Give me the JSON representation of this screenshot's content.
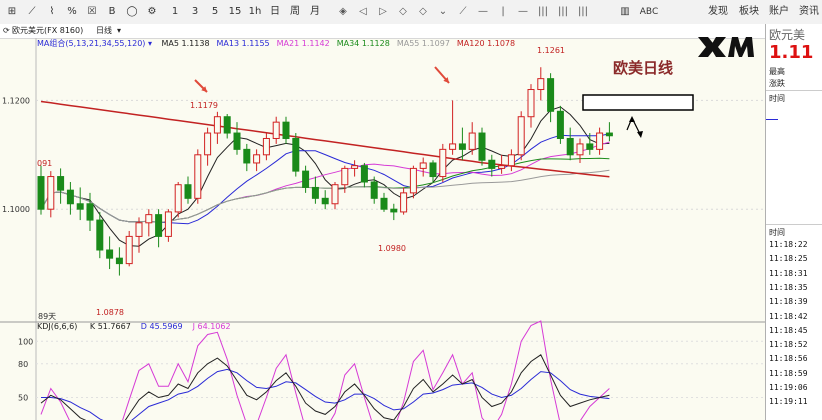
{
  "toolbar": {
    "tools": [
      {
        "name": "cursor",
        "label": "⊞"
      },
      {
        "name": "line-chart",
        "label": "⟋"
      },
      {
        "name": "candle",
        "label": "⌇"
      },
      {
        "name": "percent",
        "label": "%"
      },
      {
        "name": "x-box",
        "label": "☒"
      },
      {
        "name": "b-box",
        "label": "B"
      },
      {
        "name": "circle",
        "label": "◯"
      },
      {
        "name": "gear",
        "label": "⚙"
      }
    ],
    "periods": [
      "1",
      "3",
      "5",
      "15",
      "1h",
      "日",
      "周",
      "月"
    ],
    "nav": [
      "◈",
      "◁",
      "▷",
      "◇",
      "◇",
      "⌄",
      "⟋",
      "—",
      "|",
      "—",
      "|||",
      "|||",
      "|||"
    ],
    "right_items": [
      "ABC",
      "发现",
      "板块",
      "账户",
      "资讯"
    ]
  },
  "tab": {
    "symbol": "欧元美元(FX 8160)",
    "period": "日线"
  },
  "overlay": {
    "ma_title": "MA组合(5,13,21,34,55,120)",
    "ma": [
      {
        "label": "MA5 1.1138",
        "color": "#222222"
      },
      {
        "label": "MA13 1.1155",
        "color": "#2a2ad6"
      },
      {
        "label": "MA21 1.1142",
        "color": "#d63ad6"
      },
      {
        "label": "MA34 1.1128",
        "color": "#1c8c1c"
      },
      {
        "label": "MA55 1.1097",
        "color": "#9a9a9a"
      },
      {
        "label": "MA120 1.1078",
        "color": "#c22222"
      }
    ],
    "kdj_title": "KDJ(6,6,6)",
    "kdj": [
      {
        "label": "K 51.7667",
        "color": "#222222"
      },
      {
        "label": "D 45.5969",
        "color": "#2a2ad6"
      },
      {
        "label": "J 64.1062",
        "color": "#d63ad6"
      }
    ],
    "price_labels": {
      "high_right": "1.1261",
      "high_left": "1.1179",
      "low_mid": "1.0980",
      "low_left": "1.0878",
      "left_edge": "091"
    },
    "axis_ticks": [
      "1.1200",
      "1.1000"
    ],
    "kdj_ticks": [
      "100",
      "80",
      "50"
    ],
    "bottom_label": "89天"
  },
  "brand": {
    "title": "欧美日线",
    "logo": "XM"
  },
  "right_panel": {
    "symbol": "欧元美",
    "price": "1.11",
    "labels": [
      "最高",
      "涨跌"
    ],
    "section1": "时间",
    "section2": "时间",
    "times": [
      "11:18:22",
      "11:18:25",
      "11:18:31",
      "11:18:35",
      "11:18:39",
      "11:18:42",
      "11:18:45",
      "11:18:52",
      "11:18:56",
      "11:18:59",
      "11:19:06",
      "11:19:11"
    ]
  },
  "chart_data": {
    "type": "candlestick",
    "title": "欧美日线",
    "y_range": [
      1.08,
      1.13
    ],
    "candles": [
      {
        "o": 1.106,
        "h": 1.108,
        "l": 1.099,
        "c": 1.1
      },
      {
        "o": 1.1,
        "h": 1.107,
        "l": 1.0985,
        "c": 1.106
      },
      {
        "o": 1.106,
        "h": 1.1075,
        "l": 1.101,
        "c": 1.1035
      },
      {
        "o": 1.1035,
        "h": 1.105,
        "l": 1.099,
        "c": 1.101
      },
      {
        "o": 1.101,
        "h": 1.104,
        "l": 1.098,
        "c": 1.1
      },
      {
        "o": 1.101,
        "h": 1.103,
        "l": 1.096,
        "c": 1.098
      },
      {
        "o": 1.098,
        "h": 1.0995,
        "l": 1.091,
        "c": 1.0925
      },
      {
        "o": 1.0925,
        "h": 1.095,
        "l": 1.089,
        "c": 1.091
      },
      {
        "o": 1.091,
        "h": 1.093,
        "l": 1.0878,
        "c": 1.09
      },
      {
        "o": 1.09,
        "h": 1.096,
        "l": 1.0895,
        "c": 1.095
      },
      {
        "o": 1.095,
        "h": 1.0985,
        "l": 1.092,
        "c": 1.0975
      },
      {
        "o": 1.0975,
        "h": 1.1,
        "l": 1.095,
        "c": 1.099
      },
      {
        "o": 1.099,
        "h": 1.1,
        "l": 1.093,
        "c": 1.095
      },
      {
        "o": 1.095,
        "h": 1.1,
        "l": 1.094,
        "c": 1.0995
      },
      {
        "o": 1.0995,
        "h": 1.105,
        "l": 1.0985,
        "c": 1.1045
      },
      {
        "o": 1.1045,
        "h": 1.106,
        "l": 1.101,
        "c": 1.102
      },
      {
        "o": 1.102,
        "h": 1.111,
        "l": 1.101,
        "c": 1.11
      },
      {
        "o": 1.11,
        "h": 1.115,
        "l": 1.108,
        "c": 1.114
      },
      {
        "o": 1.114,
        "h": 1.1179,
        "l": 1.112,
        "c": 1.117
      },
      {
        "o": 1.117,
        "h": 1.1175,
        "l": 1.113,
        "c": 1.114
      },
      {
        "o": 1.114,
        "h": 1.116,
        "l": 1.11,
        "c": 1.111
      },
      {
        "o": 1.111,
        "h": 1.112,
        "l": 1.107,
        "c": 1.1085
      },
      {
        "o": 1.1085,
        "h": 1.111,
        "l": 1.107,
        "c": 1.11
      },
      {
        "o": 1.11,
        "h": 1.114,
        "l": 1.109,
        "c": 1.113
      },
      {
        "o": 1.113,
        "h": 1.117,
        "l": 1.112,
        "c": 1.116
      },
      {
        "o": 1.116,
        "h": 1.117,
        "l": 1.112,
        "c": 1.113
      },
      {
        "o": 1.113,
        "h": 1.114,
        "l": 1.106,
        "c": 1.107
      },
      {
        "o": 1.107,
        "h": 1.108,
        "l": 1.103,
        "c": 1.104
      },
      {
        "o": 1.104,
        "h": 1.106,
        "l": 1.101,
        "c": 1.102
      },
      {
        "o": 1.102,
        "h": 1.1035,
        "l": 1.1,
        "c": 1.101
      },
      {
        "o": 1.101,
        "h": 1.105,
        "l": 1.1,
        "c": 1.1045
      },
      {
        "o": 1.1045,
        "h": 1.108,
        "l": 1.103,
        "c": 1.1075
      },
      {
        "o": 1.1075,
        "h": 1.109,
        "l": 1.106,
        "c": 1.108
      },
      {
        "o": 1.108,
        "h": 1.1085,
        "l": 1.104,
        "c": 1.105
      },
      {
        "o": 1.105,
        "h": 1.106,
        "l": 1.101,
        "c": 1.102
      },
      {
        "o": 1.102,
        "h": 1.103,
        "l": 1.0995,
        "c": 1.1
      },
      {
        "o": 1.1,
        "h": 1.101,
        "l": 1.098,
        "c": 1.0995
      },
      {
        "o": 1.0995,
        "h": 1.104,
        "l": 1.099,
        "c": 1.103
      },
      {
        "o": 1.103,
        "h": 1.108,
        "l": 1.102,
        "c": 1.1075
      },
      {
        "o": 1.1075,
        "h": 1.1095,
        "l": 1.106,
        "c": 1.1085
      },
      {
        "o": 1.1085,
        "h": 1.109,
        "l": 1.105,
        "c": 1.106
      },
      {
        "o": 1.106,
        "h": 1.112,
        "l": 1.105,
        "c": 1.111
      },
      {
        "o": 1.111,
        "h": 1.12,
        "l": 1.11,
        "c": 1.112
      },
      {
        "o": 1.112,
        "h": 1.115,
        "l": 1.109,
        "c": 1.111
      },
      {
        "o": 1.111,
        "h": 1.116,
        "l": 1.11,
        "c": 1.114
      },
      {
        "o": 1.114,
        "h": 1.115,
        "l": 1.108,
        "c": 1.109
      },
      {
        "o": 1.109,
        "h": 1.11,
        "l": 1.106,
        "c": 1.1075
      },
      {
        "o": 1.1075,
        "h": 1.11,
        "l": 1.1065,
        "c": 1.108
      },
      {
        "o": 1.108,
        "h": 1.111,
        "l": 1.107,
        "c": 1.11
      },
      {
        "o": 1.11,
        "h": 1.118,
        "l": 1.109,
        "c": 1.117
      },
      {
        "o": 1.117,
        "h": 1.123,
        "l": 1.115,
        "c": 1.122
      },
      {
        "o": 1.122,
        "h": 1.1261,
        "l": 1.12,
        "c": 1.124
      },
      {
        "o": 1.124,
        "h": 1.125,
        "l": 1.116,
        "c": 1.118
      },
      {
        "o": 1.118,
        "h": 1.119,
        "l": 1.112,
        "c": 1.113
      },
      {
        "o": 1.113,
        "h": 1.115,
        "l": 1.109,
        "c": 1.11
      },
      {
        "o": 1.11,
        "h": 1.113,
        "l": 1.1085,
        "c": 1.112
      },
      {
        "o": 1.112,
        "h": 1.114,
        "l": 1.11,
        "c": 1.111
      },
      {
        "o": 1.111,
        "h": 1.115,
        "l": 1.11,
        "c": 1.114
      },
      {
        "o": 1.114,
        "h": 1.116,
        "l": 1.1125,
        "c": 1.1135
      }
    ],
    "kdj": {
      "K": [
        45,
        52,
        48,
        40,
        32,
        28,
        20,
        18,
        22,
        35,
        48,
        55,
        50,
        52,
        62,
        58,
        72,
        80,
        85,
        78,
        65,
        52,
        48,
        55,
        65,
        72,
        60,
        45,
        38,
        35,
        42,
        55,
        62,
        52,
        40,
        32,
        30,
        42,
        58,
        66,
        55,
        62,
        70,
        62,
        66,
        50,
        42,
        45,
        55,
        72,
        82,
        88,
        70,
        52,
        42,
        45,
        48,
        50,
        52
      ],
      "D": [
        50,
        50,
        49,
        46,
        41,
        37,
        31,
        27,
        25,
        28,
        35,
        42,
        45,
        48,
        53,
        55,
        60,
        67,
        73,
        75,
        72,
        65,
        59,
        58,
        60,
        64,
        63,
        57,
        51,
        46,
        45,
        48,
        53,
        53,
        49,
        43,
        39,
        40,
        46,
        53,
        54,
        57,
        61,
        62,
        63,
        59,
        53,
        50,
        52,
        58,
        66,
        73,
        72,
        65,
        57,
        53,
        51,
        50,
        49
      ],
      "J": [
        35,
        58,
        46,
        28,
        14,
        10,
        -2,
        0,
        16,
        48,
        74,
        80,
        60,
        60,
        80,
        64,
        96,
        106,
        108,
        84,
        52,
        26,
        26,
        50,
        76,
        88,
        54,
        22,
        12,
        14,
        36,
        70,
        80,
        50,
        22,
        10,
        12,
        46,
        82,
        92,
        57,
        72,
        88,
        62,
        72,
        32,
        20,
        35,
        62,
        100,
        114,
        118,
        66,
        26,
        12,
        29,
        42,
        50,
        58
      ]
    }
  }
}
